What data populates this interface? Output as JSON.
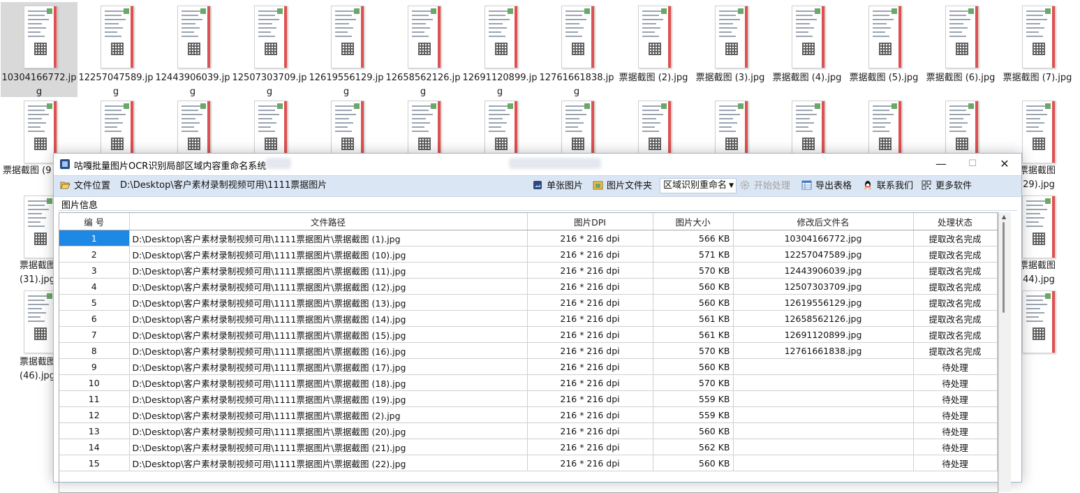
{
  "desktop": {
    "row1": [
      {
        "name": "10304166772.jpg",
        "selected": true
      },
      {
        "name": "12257047589.jpg"
      },
      {
        "name": "12443906039.jpg"
      },
      {
        "name": "12507303709.jpg"
      },
      {
        "name": "12619556129.jpg"
      },
      {
        "name": "12658562126.jpg"
      },
      {
        "name": "12691120899.jpg"
      },
      {
        "name": "12761661838.jpg"
      },
      {
        "name": "票据截图 (2).jpg"
      },
      {
        "name": "票据截图 (3).jpg"
      },
      {
        "name": "票据截图 (4).jpg"
      },
      {
        "name": "票据截图 (5).jpg"
      },
      {
        "name": "票据截图 (6).jpg"
      },
      {
        "name": "票据截图 (7).jpg"
      }
    ],
    "partial_labels": {
      "row2_left": "票据截图 (9",
      "row2_right": "票据截图 (29).jpg",
      "row3_left": "票据截图 (31).jpg",
      "row3_right": "票据截图 (44).jpg",
      "row4_left": "票据截图 (46).jpg"
    }
  },
  "window": {
    "title": "咕嘎批量图片OCR识别局部区域内容重命名系统",
    "controls": {
      "minimize": "—",
      "maximize": "☐",
      "close": "✕"
    }
  },
  "toolbar": {
    "file_location_label": "文件位置",
    "path_value": "D:\\Desktop\\客户素材录制视频可用\\1111票据图片",
    "single_image": "单张图片",
    "image_folder": "图片文件夹",
    "mode_value": "区域识别重命名",
    "start": "开始处理",
    "export": "导出表格",
    "contact": "联系我们",
    "more": "更多软件"
  },
  "group_label": "图片信息",
  "table": {
    "columns": [
      "编 号",
      "文件路径",
      "图片DPI",
      "图片大小",
      "修改后文件名",
      "处理状态"
    ],
    "rows": [
      [
        "1",
        "D:\\Desktop\\客户素材录制视频可用\\1111票据图片\\票据截图 (1).jpg",
        "216 * 216 dpi",
        "566 KB",
        "10304166772.jpg",
        "提取改名完成"
      ],
      [
        "2",
        "D:\\Desktop\\客户素材录制视频可用\\1111票据图片\\票据截图 (10).jpg",
        "216 * 216 dpi",
        "571 KB",
        "12257047589.jpg",
        "提取改名完成"
      ],
      [
        "3",
        "D:\\Desktop\\客户素材录制视频可用\\1111票据图片\\票据截图 (11).jpg",
        "216 * 216 dpi",
        "570 KB",
        "12443906039.jpg",
        "提取改名完成"
      ],
      [
        "4",
        "D:\\Desktop\\客户素材录制视频可用\\1111票据图片\\票据截图 (12).jpg",
        "216 * 216 dpi",
        "560 KB",
        "12507303709.jpg",
        "提取改名完成"
      ],
      [
        "5",
        "D:\\Desktop\\客户素材录制视频可用\\1111票据图片\\票据截图 (13).jpg",
        "216 * 216 dpi",
        "560 KB",
        "12619556129.jpg",
        "提取改名完成"
      ],
      [
        "6",
        "D:\\Desktop\\客户素材录制视频可用\\1111票据图片\\票据截图 (14).jpg",
        "216 * 216 dpi",
        "561 KB",
        "12658562126.jpg",
        "提取改名完成"
      ],
      [
        "7",
        "D:\\Desktop\\客户素材录制视频可用\\1111票据图片\\票据截图 (15).jpg",
        "216 * 216 dpi",
        "561 KB",
        "12691120899.jpg",
        "提取改名完成"
      ],
      [
        "8",
        "D:\\Desktop\\客户素材录制视频可用\\1111票据图片\\票据截图 (16).jpg",
        "216 * 216 dpi",
        "570 KB",
        "12761661838.jpg",
        "提取改名完成"
      ],
      [
        "9",
        "D:\\Desktop\\客户素材录制视频可用\\1111票据图片\\票据截图 (17).jpg",
        "216 * 216 dpi",
        "560 KB",
        "",
        "待处理"
      ],
      [
        "10",
        "D:\\Desktop\\客户素材录制视频可用\\1111票据图片\\票据截图 (18).jpg",
        "216 * 216 dpi",
        "570 KB",
        "",
        "待处理"
      ],
      [
        "11",
        "D:\\Desktop\\客户素材录制视频可用\\1111票据图片\\票据截图 (19).jpg",
        "216 * 216 dpi",
        "559 KB",
        "",
        "待处理"
      ],
      [
        "12",
        "D:\\Desktop\\客户素材录制视频可用\\1111票据图片\\票据截图 (2).jpg",
        "216 * 216 dpi",
        "559 KB",
        "",
        "待处理"
      ],
      [
        "13",
        "D:\\Desktop\\客户素材录制视频可用\\1111票据图片\\票据截图 (20).jpg",
        "216 * 216 dpi",
        "560 KB",
        "",
        "待处理"
      ],
      [
        "14",
        "D:\\Desktop\\客户素材录制视频可用\\1111票据图片\\票据截图 (21).jpg",
        "216 * 216 dpi",
        "562 KB",
        "",
        "待处理"
      ],
      [
        "15",
        "D:\\Desktop\\客户素材录制视频可用\\1111票据图片\\票据截图 (22).jpg",
        "216 * 216 dpi",
        "560 KB",
        "",
        "待处理"
      ]
    ],
    "selected_row": 1
  }
}
